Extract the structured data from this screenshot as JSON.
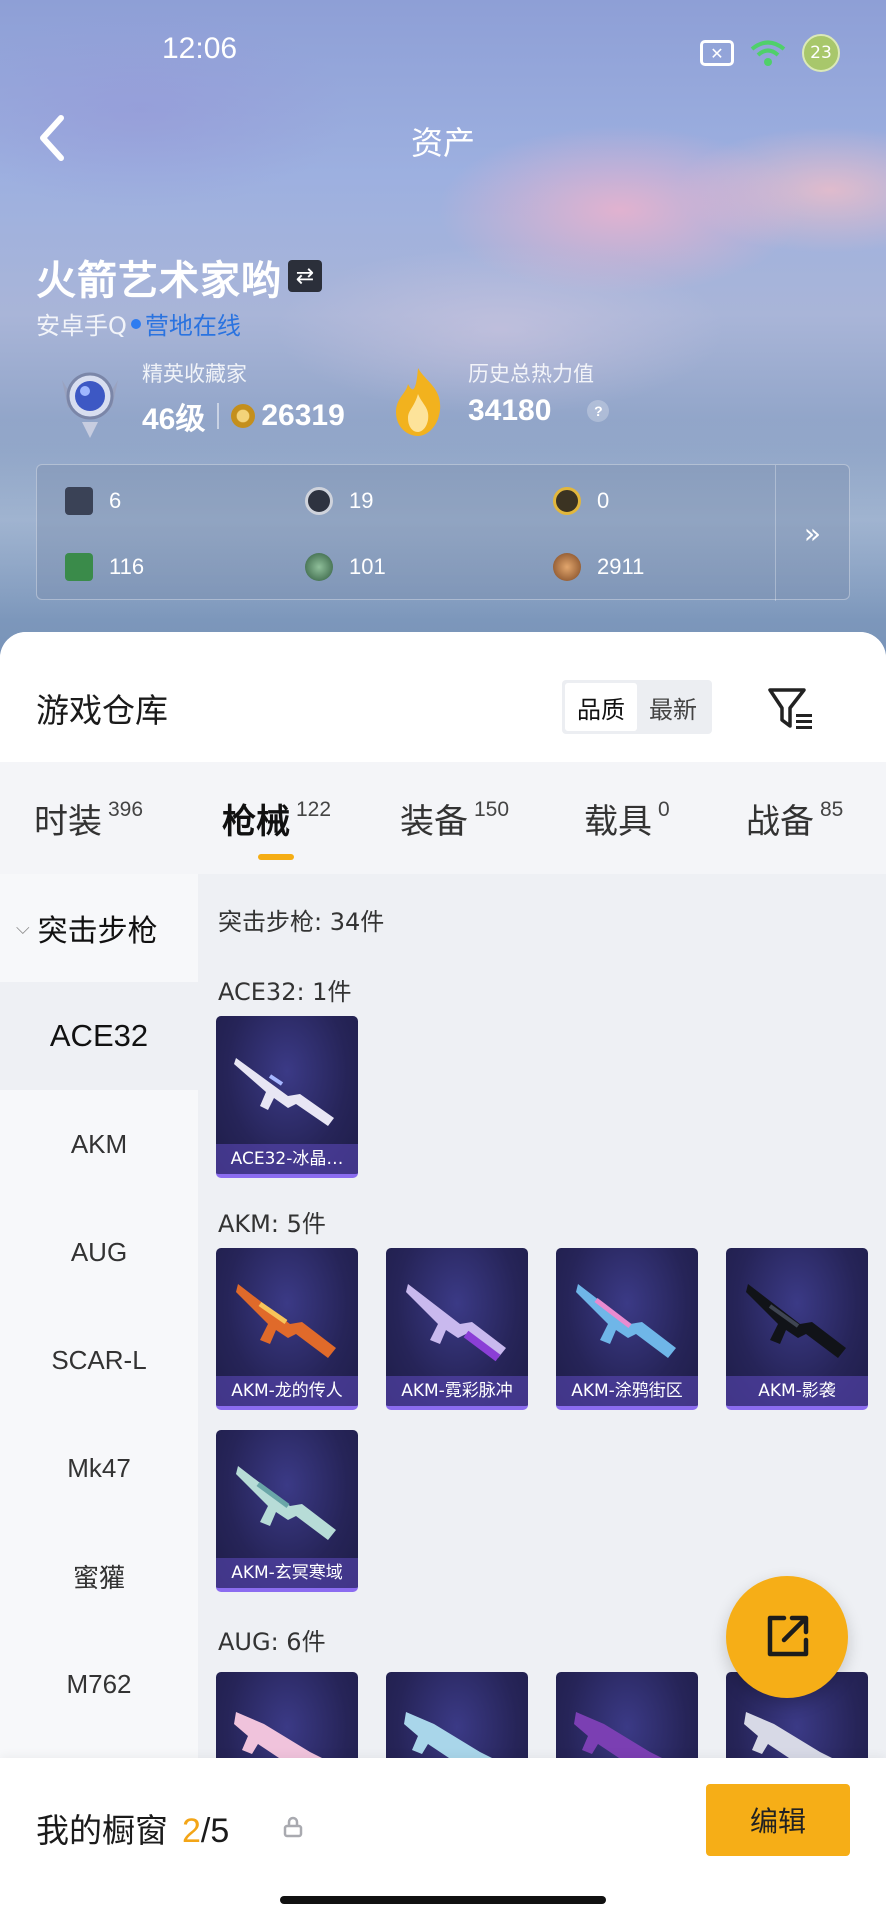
{
  "status": {
    "time": "12:06",
    "notification_count": "23"
  },
  "nav": {
    "title": "资产"
  },
  "profile": {
    "name": "火箭艺术家哟",
    "platform": "安卓手Q",
    "online_status": "营地在线",
    "rank_title": "精英收藏家",
    "level": "46级",
    "coins": "26319",
    "heat_label": "历史总热力值",
    "heat_value": "34180"
  },
  "assets": {
    "row1": [
      "6",
      "19",
      "0"
    ],
    "row2": [
      "116",
      "101",
      "2911"
    ]
  },
  "warehouse": {
    "title": "游戏仓库",
    "sort_options": [
      "品质",
      "最新"
    ],
    "active_sort": "品质"
  },
  "tabs": [
    {
      "label": "时装",
      "count": "396"
    },
    {
      "label": "枪械",
      "count": "122"
    },
    {
      "label": "装备",
      "count": "150"
    },
    {
      "label": "载具",
      "count": "0"
    },
    {
      "label": "战备",
      "count": "85"
    }
  ],
  "active_tab": "枪械",
  "sidebar": {
    "category": "突击步枪",
    "items": [
      "ACE32",
      "AKM",
      "AUG",
      "SCAR-L",
      "Mk47",
      "蜜獾",
      "M762"
    ],
    "active": "ACE32"
  },
  "content": {
    "category_total": "突击步枪: 34件",
    "groups": [
      {
        "label": "ACE32: 1件",
        "items": [
          "ACE32-冰晶…"
        ]
      },
      {
        "label": "AKM: 5件",
        "items": [
          "AKM-龙的传人",
          "AKM-霓彩脉冲",
          "AKM-涂鸦街区",
          "AKM-影袭",
          "AKM-玄冥寒域"
        ]
      },
      {
        "label": "AUG: 6件",
        "items": [
          "",
          "",
          "",
          ""
        ]
      }
    ]
  },
  "bottom": {
    "showcase_label": "我的橱窗",
    "showcase_current": "2",
    "showcase_total": "/5",
    "edit_label": "编辑"
  },
  "colors": {
    "accent": "#f6ae17",
    "online": "#2a73e0",
    "card_bg": "#262458"
  }
}
